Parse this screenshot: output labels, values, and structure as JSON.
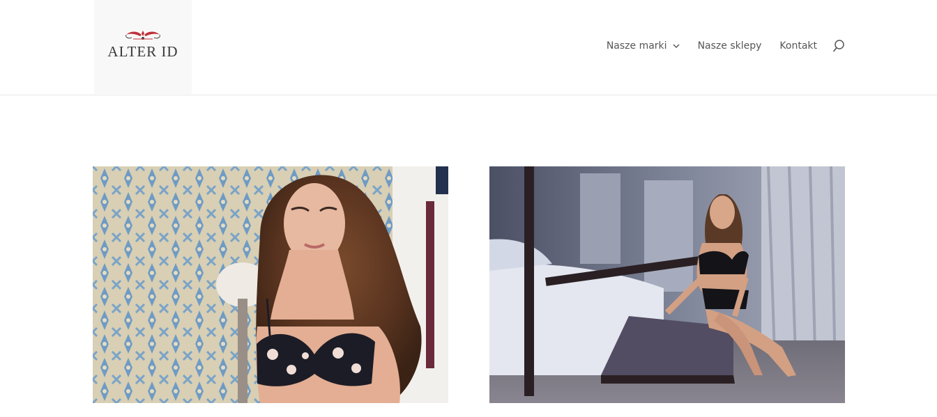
{
  "header": {
    "logo": {
      "text": "ALTER ID"
    },
    "nav": {
      "items": [
        {
          "label": "Nasze marki",
          "has_dropdown": true
        },
        {
          "label": "Nasze sklepy",
          "has_dropdown": false
        },
        {
          "label": "Kontakt",
          "has_dropdown": false
        }
      ],
      "search_icon": "search-icon"
    }
  },
  "main": {
    "cards": [
      {
        "image": "photo-woman-floral-bra"
      },
      {
        "image": "photo-woman-black-lingerie-bedroom"
      }
    ]
  },
  "colors": {
    "header_border": "#e6e6e6",
    "logo_accent": "#c0303a",
    "nav_text": "#555555"
  }
}
